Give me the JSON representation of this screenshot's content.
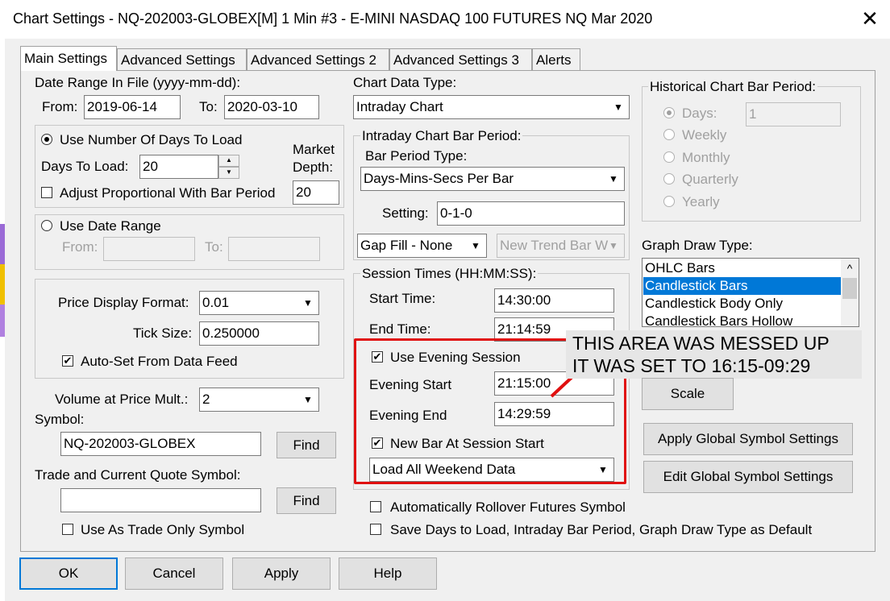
{
  "window": {
    "title": "Chart Settings - NQ-202003-GLOBEX[M]  1 Min   #3 - E-MINI NASDAQ 100 FUTURES NQ Mar 2020",
    "close_glyph": "✕"
  },
  "tabs": [
    "Main Settings",
    "Advanced Settings",
    "Advanced Settings 2",
    "Advanced Settings 3",
    "Alerts"
  ],
  "date_range": {
    "header": "Date Range In File (yyyy-mm-dd):",
    "from_label": "From:",
    "from_value": "2019-06-14",
    "to_label": "To:",
    "to_value": "2020-03-10"
  },
  "days_group": {
    "use_days_label": "Use Number Of Days To Load",
    "days_to_load_label": "Days To Load:",
    "days_to_load_value": "20",
    "market_depth_label_1": "Market",
    "market_depth_label_2": "Depth:",
    "market_depth_value": "20",
    "adjust_label": "Adjust Proportional With Bar Period"
  },
  "date_range_group": {
    "use_date_range_label": "Use Date Range",
    "from_label": "From:",
    "to_label": "To:"
  },
  "price_group": {
    "price_format_label": "Price Display Format:",
    "price_format_value": "0.01",
    "tick_size_label": "Tick Size:",
    "tick_size_value": "0.250000",
    "auto_set_label": "Auto-Set From Data Feed"
  },
  "volume": {
    "label": "Volume at Price Mult.:",
    "value": "2"
  },
  "symbol": {
    "label": "Symbol:",
    "value": "NQ-202003-GLOBEX",
    "find_label": "Find",
    "trade_quote_label": "Trade and Current Quote Symbol:",
    "trade_quote_value": "",
    "find2_label": "Find",
    "trade_only_label": "Use As Trade Only Symbol"
  },
  "chart_data_type": {
    "label": "Chart Data Type:",
    "value": "Intraday Chart"
  },
  "intraday": {
    "title": "Intraday Chart Bar Period:",
    "bar_period_type_label": "Bar Period Type:",
    "bar_period_type_value": "Days-Mins-Secs Per Bar",
    "setting_label": "Setting:",
    "setting_value": "0-1-0",
    "gap_fill_value": "Gap Fill - None",
    "new_trend_value": "New Trend Bar W"
  },
  "session": {
    "title": "Session Times (HH:MM:SS):",
    "start_label": "Start Time:",
    "start_value": "14:30:00",
    "end_label": "End Time:",
    "end_value": "21:14:59",
    "use_evening_label": "Use Evening Session",
    "evening_start_label": "Evening Start",
    "evening_start_value": "21:15:00",
    "evening_end_label": "Evening End",
    "evening_end_value": "14:29:59",
    "new_bar_label": "New Bar At Session Start",
    "weekend_value": "Load All Weekend Data"
  },
  "historical": {
    "title": "Historical Chart Bar Period:",
    "days_label": "Days:",
    "days_value": "1",
    "weekly_label": "Weekly",
    "monthly_label": "Monthly",
    "quarterly_label": "Quarterly",
    "yearly_label": "Yearly"
  },
  "graph_draw": {
    "label": "Graph Draw Type:",
    "items": [
      "OHLC Bars",
      "Candlestick Bars",
      "Candlestick Body Only",
      "Candlestick Bars Hollow"
    ],
    "selected_index": 1
  },
  "annotation": {
    "line1": "THIS AREA WAS MESSED UP",
    "line2": "IT WAS SET TO 16:15-09:29"
  },
  "right_buttons": {
    "scale": "Scale",
    "apply_global": "Apply Global Symbol Settings",
    "edit_global": "Edit Global Symbol Settings"
  },
  "bottom_checks": {
    "rollover": "Automatically Rollover Futures Symbol",
    "save_default": "Save Days to Load, Intraday Bar Period, Graph Draw Type as Default"
  },
  "footer_buttons": {
    "ok": "OK",
    "cancel": "Cancel",
    "apply": "Apply",
    "help": "Help"
  },
  "colors": {
    "selection": "#0078d7",
    "annotation_red": "#e01010"
  }
}
